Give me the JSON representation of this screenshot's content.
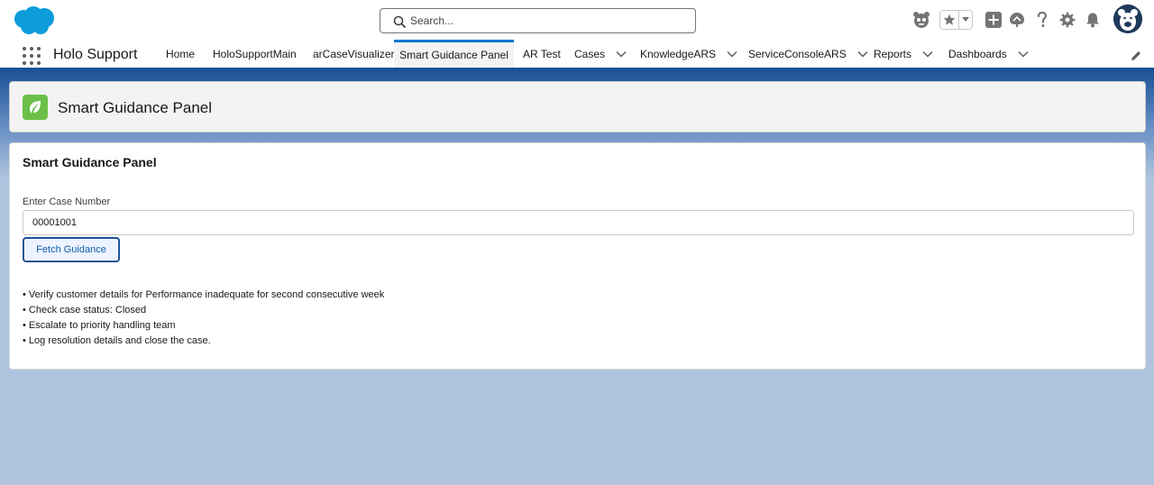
{
  "global_header": {
    "search_placeholder": "Search...",
    "icons": [
      "salesforce-logo",
      "search-icon",
      "agentforce-icon",
      "favorites-star-icon",
      "favorites-dropdown-icon",
      "global-actions-add-icon",
      "trailhead-icon",
      "help-icon",
      "setup-gear-icon",
      "notifications-bell-icon",
      "user-avatar"
    ]
  },
  "nav": {
    "app_name": "Holo Support",
    "tabs": [
      {
        "label": "Home",
        "has_menu": false
      },
      {
        "label": "HoloSupportMain",
        "has_menu": false
      },
      {
        "label": "arCaseVisualizer",
        "has_menu": false
      },
      {
        "label": "Smart Guidance Panel",
        "has_menu": false,
        "active": true
      },
      {
        "label": "AR Test",
        "has_menu": false
      },
      {
        "label": "Cases",
        "has_menu": true
      },
      {
        "label": "KnowledgeARS",
        "has_menu": true
      },
      {
        "label": "ServiceConsoleARS",
        "has_menu": true
      },
      {
        "label": "Reports",
        "has_menu": true
      },
      {
        "label": "Dashboards",
        "has_menu": true
      }
    ]
  },
  "page_header": {
    "title": "Smart Guidance Panel"
  },
  "panel": {
    "title": "Smart Guidance Panel",
    "input_label": "Enter Case Number",
    "input_value": "00001001",
    "button_label": "Fetch Guidance",
    "guidance": [
      "• Verify customer details for Performance inadequate for second consecutive week",
      "• Check case status: Closed",
      "• Escalate to priority handling team",
      "• Log resolution details and close the case."
    ]
  },
  "colors": {
    "brand_blue": "#0176d3",
    "nav_border": "#1b5297",
    "page_icon_green": "#6cc04a",
    "background": "#b0c4df"
  }
}
